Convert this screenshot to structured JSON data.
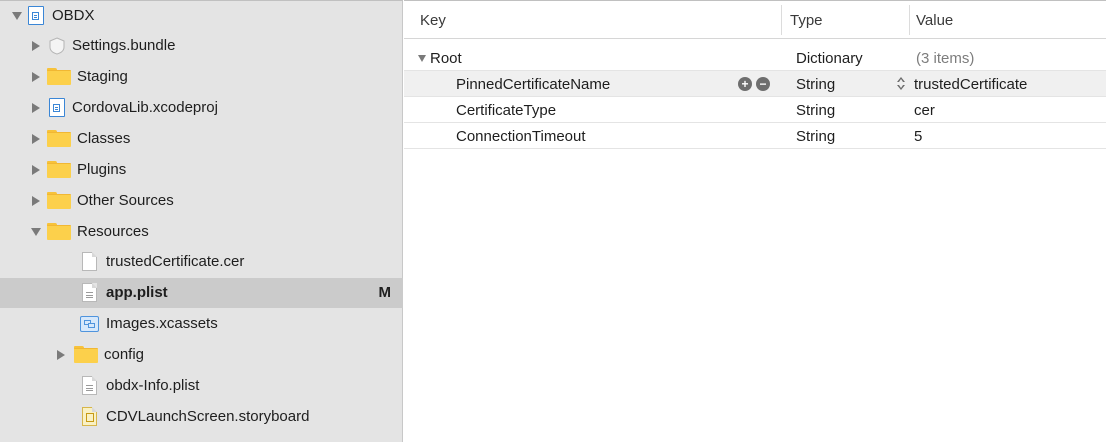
{
  "navigator": {
    "items": [
      {
        "label": "OBDX",
        "icon": "project-file-icon",
        "disclosure": "expanded"
      },
      {
        "label": "Settings.bundle",
        "icon": "bundle-icon",
        "disclosure": "collapsed"
      },
      {
        "label": "Staging",
        "icon": "folder-icon",
        "disclosure": "collapsed"
      },
      {
        "label": "CordovaLib.xcodeproj",
        "icon": "project-file-icon",
        "disclosure": "collapsed"
      },
      {
        "label": "Classes",
        "icon": "folder-icon",
        "disclosure": "collapsed"
      },
      {
        "label": "Plugins",
        "icon": "folder-icon",
        "disclosure": "collapsed"
      },
      {
        "label": "Other Sources",
        "icon": "folder-icon",
        "disclosure": "collapsed"
      },
      {
        "label": "Resources",
        "icon": "folder-icon",
        "disclosure": "expanded"
      },
      {
        "label": "trustedCertificate.cer",
        "icon": "document-icon",
        "disclosure": "none"
      },
      {
        "label": "app.plist",
        "icon": "plist-file-icon",
        "disclosure": "none",
        "badge": "M",
        "selected": true
      },
      {
        "label": "Images.xcassets",
        "icon": "asset-catalog-icon",
        "disclosure": "none"
      },
      {
        "label": "config",
        "icon": "folder-icon",
        "disclosure": "collapsed"
      },
      {
        "label": "obdx-Info.plist",
        "icon": "plist-file-icon",
        "disclosure": "none"
      },
      {
        "label": "CDVLaunchScreen.storyboard",
        "icon": "storyboard-file-icon",
        "disclosure": "none"
      }
    ]
  },
  "editor": {
    "columns": {
      "key": "Key",
      "type": "Type",
      "value": "Value"
    },
    "rows": [
      {
        "key": "Root",
        "type": "Dictionary",
        "value": "(3 items)"
      },
      {
        "key": "PinnedCertificateName",
        "type": "String",
        "value": "trustedCertificate"
      },
      {
        "key": "CertificateType",
        "type": "String",
        "value": "cer"
      },
      {
        "key": "ConnectionTimeout",
        "type": "String",
        "value": "5"
      }
    ],
    "row_controls": {
      "add": "+",
      "remove": "−"
    }
  },
  "colors": {
    "navigator_bg": "#e4e4e4",
    "selection_bg": "#cbcbcb",
    "folder": "#fcd04b",
    "project_blue": "#3a86d6"
  }
}
